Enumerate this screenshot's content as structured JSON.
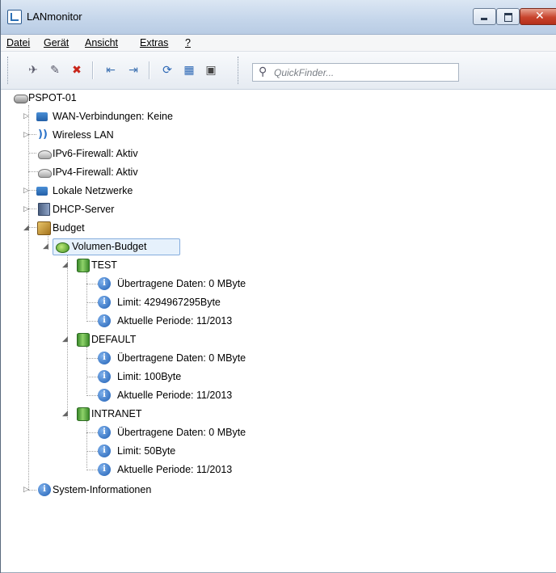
{
  "window": {
    "title": "LANmonitor",
    "minimize_glyph": "",
    "maximize_glyph": "",
    "close_glyph": "✕"
  },
  "menu": [
    {
      "label": "Datei"
    },
    {
      "label": "Gerät"
    },
    {
      "label": "Ansicht"
    },
    {
      "label": "Extras"
    },
    {
      "label": "?"
    }
  ],
  "toolbar": {
    "buttons": [
      {
        "icon": "connect-icon"
      },
      {
        "icon": "search-device-icon"
      },
      {
        "icon": "delete-icon"
      },
      {
        "icon": "back-icon"
      },
      {
        "icon": "forward-icon"
      },
      {
        "icon": "refresh-icon"
      },
      {
        "icon": "table-icon"
      },
      {
        "icon": "lock-icon"
      }
    ],
    "search_placeholder": "QuickFinder..."
  },
  "tree": {
    "root": "PSPOT-01",
    "items": {
      "wan": "WAN-Verbindungen: Keine",
      "wlan": "Wireless LAN",
      "ipv6": "IPv6-Firewall: Aktiv",
      "ipv4": "IPv4-Firewall: Aktiv",
      "lan": "Lokale Netzwerke",
      "dhcp": "DHCP-Server",
      "budget": "Budget",
      "volumen": "Volumen-Budget",
      "sysinfo": "System-Informationen"
    },
    "groups": [
      {
        "name": "TEST",
        "data": "Übertragene Daten: 0 MByte",
        "limit": "Limit: 4294967295Byte",
        "period": "Aktuelle Periode: 11/2013"
      },
      {
        "name": "DEFAULT",
        "data": "Übertragene Daten: 0 MByte",
        "limit": "Limit: 100Byte",
        "period": "Aktuelle Periode: 11/2013"
      },
      {
        "name": "INTRANET",
        "data": "Übertragene Daten: 0 MByte",
        "limit": "Limit: 50Byte",
        "period": "Aktuelle Periode: 11/2013"
      }
    ]
  }
}
